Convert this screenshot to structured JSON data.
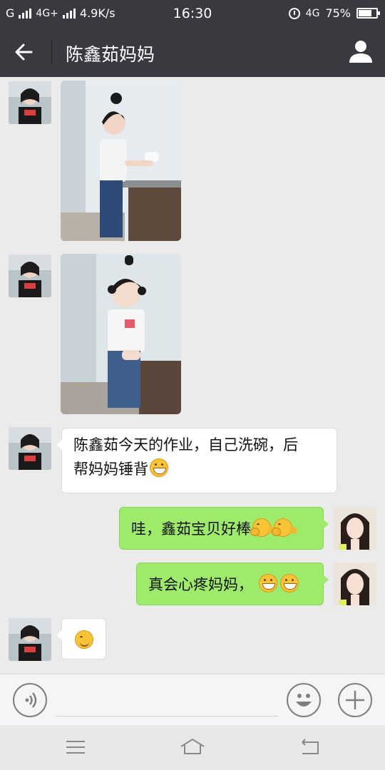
{
  "status_bar": {
    "carrier1": "G",
    "carrier2": "4G+",
    "speed": "4.9K/s",
    "time": "16:30",
    "net_right": "4G",
    "battery_text": "75%",
    "battery_level": 0.75
  },
  "header": {
    "title": "陈鑫茹妈妈",
    "back_icon": "back-arrow-icon",
    "profile_icon": "person-icon"
  },
  "messages": [
    {
      "direction": "in",
      "type": "image",
      "icon": "photo-girl-washing-bowl"
    },
    {
      "direction": "in",
      "type": "image",
      "icon": "photo-girl-washing-bowl"
    },
    {
      "direction": "in",
      "type": "text",
      "lines": [
        "陈鑫茹今天的作业，自己洗碗，后",
        "帮妈妈锤背"
      ],
      "emojis": [
        "grin"
      ]
    },
    {
      "direction": "out",
      "type": "text",
      "lines": [
        "哇，鑫茹宝贝好棒"
      ],
      "emojis": [
        "hug",
        "hug"
      ]
    },
    {
      "direction": "out",
      "type": "text",
      "lines": [
        "真会心疼妈妈，"
      ],
      "emojis": [
        "grin",
        "grin"
      ]
    },
    {
      "direction": "in",
      "type": "text",
      "lines": [
        ""
      ],
      "emojis": [
        "smile"
      ]
    }
  ],
  "input_bar": {
    "voice_icon": "voice-icon",
    "emoji_icon": "emoji-icon",
    "plus_icon": "plus-icon"
  },
  "nav_bar": {
    "menu_icon": "menu-icon",
    "home_icon": "home-icon",
    "back_icon": "return-icon"
  },
  "colors": {
    "header_bg": "#393a3f",
    "chat_bg": "#ebebeb",
    "bubble_out": "#9eea6a",
    "bubble_in": "#ffffff"
  }
}
